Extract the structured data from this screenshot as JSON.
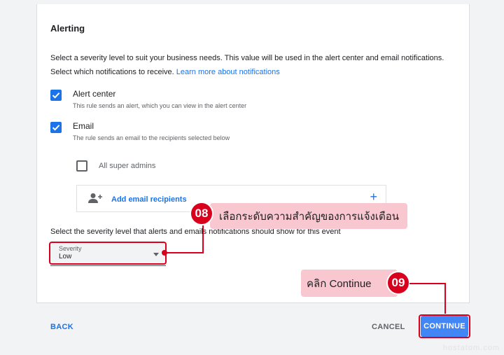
{
  "alerting": {
    "title": "Alerting",
    "desc_severity": "Select a severity level to suit your business needs. This value will be used in the alert center and email notifications.",
    "desc_notifications": "Select which notifications to receive.",
    "learn_more_link": "Learn more about notifications"
  },
  "options": {
    "alert_center": {
      "label": "Alert center",
      "sub": "This rule sends an alert, which you can view in the alert center",
      "checked": true
    },
    "email": {
      "label": "Email",
      "sub": "The rule sends an email to the recipients selected below",
      "checked": true
    },
    "super_admins": {
      "label": "All super admins",
      "checked": false
    }
  },
  "recipients": {
    "add_label": "Add email recipients",
    "plus": "+"
  },
  "severity": {
    "prompt": "Select the severity level that alerts and emails notifications should show for this event",
    "field_label": "Severity",
    "value": "Low"
  },
  "annotations": {
    "step8": {
      "number": "08",
      "text": "เลือกระดับความสำคัญของการแจ้งเตือน"
    },
    "step9": {
      "number": "09",
      "text": "คลิก Continue"
    },
    "color": "#d8001c"
  },
  "footer": {
    "back": "BACK",
    "cancel": "CANCEL",
    "continue": "CONTINUE"
  },
  "watermark": "hostatom.com",
  "colors": {
    "accent": "#1a73e8",
    "primary_button": "#4285f4",
    "callout_bg": "#f9c7cf"
  }
}
